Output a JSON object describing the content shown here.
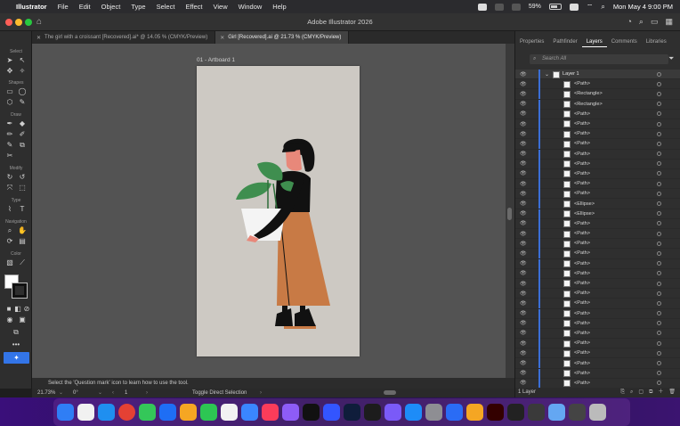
{
  "menubar": {
    "app_name": "Illustrator",
    "items": [
      "File",
      "Edit",
      "Object",
      "Type",
      "Select",
      "Effect",
      "View",
      "Window",
      "Help"
    ],
    "battery": "59%",
    "clock": "Mon May 4  9:00 PM"
  },
  "window": {
    "title": "Adobe Illustrator 2026"
  },
  "tabs": [
    {
      "label": "The girl with a croissant [Recovered].ai* @ 14.05 % (CMYK/Preview)",
      "active": false
    },
    {
      "label": "Girl [Recovered].ai @ 21.73 % (CMYK/Preview)",
      "active": true
    }
  ],
  "toolbar": {
    "groups": [
      "Select",
      "Shapes",
      "Draw",
      "Modify",
      "Type",
      "Navigation",
      "Color"
    ]
  },
  "canvas": {
    "artboard_label": "01 - Artboard 1"
  },
  "status": {
    "hint": "Select the 'Question mark' icon to learn how to use the tool.",
    "zoom": "21.73%",
    "rotation": "0°",
    "artboard_num": "1",
    "tool_name": "Toggle Direct Selection"
  },
  "panel": {
    "tabs": [
      "Properties",
      "Pathfinder",
      "Layers",
      "Comments",
      "Libraries"
    ],
    "active_tab": "Layers",
    "search_placeholder": "Search All",
    "layer_name": "Layer 1",
    "layers": [
      "<Path>",
      "<Rectangle>",
      "<Rectangle>",
      "<Path>",
      "<Path>",
      "<Path>",
      "<Path>",
      "<Path>",
      "<Path>",
      "<Path>",
      "<Path>",
      "<Path>",
      "<Ellipse>",
      "<Ellipse>",
      "<Path>",
      "<Path>",
      "<Path>",
      "<Path>",
      "<Path>",
      "<Path>",
      "<Path>",
      "<Path>",
      "<Path>",
      "<Path>",
      "<Path>",
      "<Path>",
      "<Path>",
      "<Path>",
      "<Path>",
      "<Path>",
      "<Path>",
      "<Path>",
      "<Path>"
    ],
    "footer": "1 Layer"
  },
  "colors": {
    "accent": "#3375e8",
    "artboard": "#cdc9c3",
    "skirt": "#c87a45",
    "leaf": "#3f8e4f",
    "skin": "#e8887a"
  }
}
